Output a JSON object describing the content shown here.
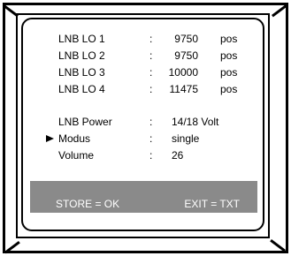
{
  "lnb": [
    {
      "label": "LNB LO 1",
      "colon": ":",
      "value": "9750",
      "unit": "pos"
    },
    {
      "label": "LNB LO 2",
      "colon": ":",
      "value": "9750",
      "unit": "pos"
    },
    {
      "label": "LNB LO 3",
      "colon": ":",
      "value": "10000",
      "unit": "pos"
    },
    {
      "label": "LNB LO 4",
      "colon": ":",
      "value": "11475",
      "unit": "pos"
    }
  ],
  "settings": [
    {
      "label": "LNB Power",
      "colon": ":",
      "value": "14/18 Volt"
    },
    {
      "label": "Modus",
      "colon": ":",
      "value": "single"
    },
    {
      "label": "Volume",
      "colon": ":",
      "value": "26"
    }
  ],
  "footer": {
    "store_label": "STORE = OK",
    "exit_label": "EXIT = TXT",
    "bar_color": "#8a8a8a"
  }
}
